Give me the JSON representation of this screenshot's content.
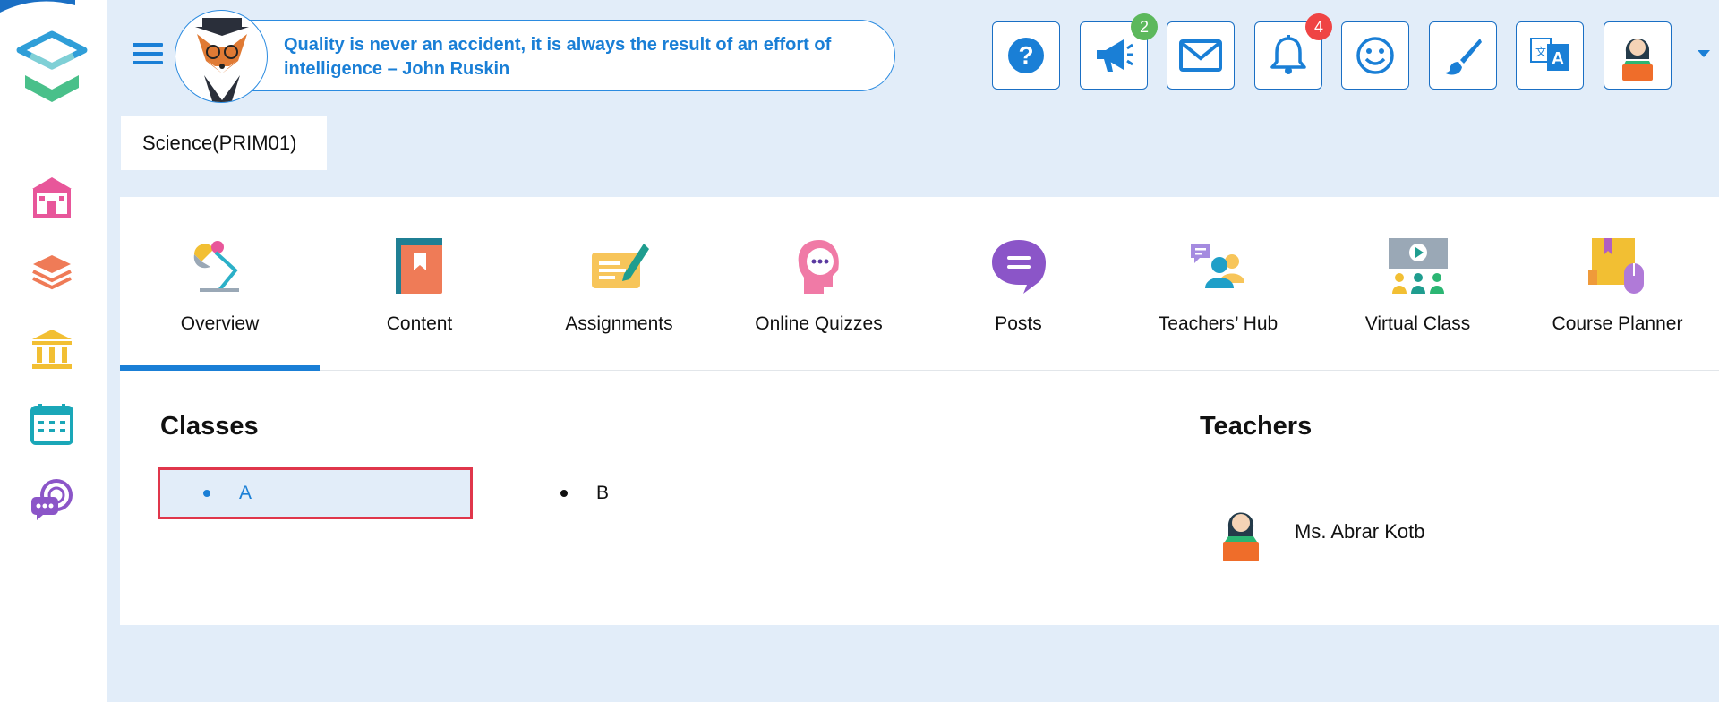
{
  "header": {
    "quote": "Quality is never an accident, it is always the result of an effort of intelligence – John Ruskin",
    "announcements_badge": "2",
    "notifications_badge": "4"
  },
  "course": {
    "title": "Science(PRIM01)"
  },
  "tabs": [
    {
      "label": "Overview",
      "icon": "desk-lamp-icon"
    },
    {
      "label": "Content",
      "icon": "book-icon"
    },
    {
      "label": "Assignments",
      "icon": "pen-paper-icon"
    },
    {
      "label": "Online Quizzes",
      "icon": "thinking-head-icon"
    },
    {
      "label": "Posts",
      "icon": "chat-bubble-icon"
    },
    {
      "label": "Teachers’ Hub",
      "icon": "teachers-group-icon"
    },
    {
      "label": "Virtual Class",
      "icon": "virtual-class-icon"
    },
    {
      "label": "Course Planner",
      "icon": "planner-icon"
    }
  ],
  "classes": {
    "heading": "Classes",
    "items": [
      "A",
      "B"
    ]
  },
  "teachers": {
    "heading": "Teachers",
    "items": [
      "Ms. Abrar Kotb"
    ]
  },
  "colors": {
    "accent": "#1a7fd6",
    "background": "#e2edf9",
    "badge_green": "#5cb85c",
    "badge_red": "#ef4444",
    "highlight_border": "#e0364b"
  }
}
